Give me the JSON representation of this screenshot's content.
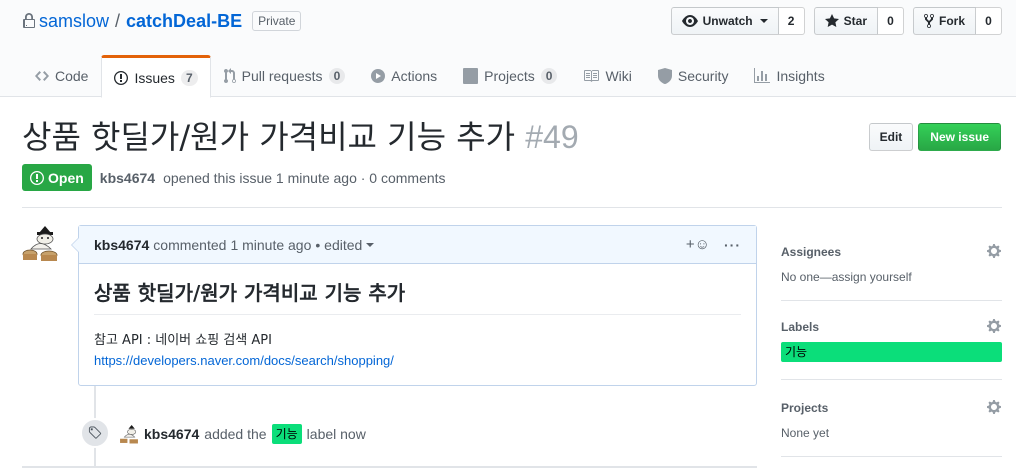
{
  "repo": {
    "owner": "samslow",
    "separator": "/",
    "name": "catchDeal-BE",
    "visibility": "Private"
  },
  "actions": {
    "watch": {
      "label": "Unwatch",
      "count": "2"
    },
    "star": {
      "label": "Star",
      "count": "0"
    },
    "fork": {
      "label": "Fork",
      "count": "0"
    }
  },
  "tabs": [
    {
      "label": "Code"
    },
    {
      "label": "Issues",
      "count": "7"
    },
    {
      "label": "Pull requests",
      "count": "0"
    },
    {
      "label": "Actions"
    },
    {
      "label": "Projects",
      "count": "0"
    },
    {
      "label": "Wiki"
    },
    {
      "label": "Security"
    },
    {
      "label": "Insights"
    }
  ],
  "issue": {
    "title": "상품 핫딜가/원가 가격비교 기능 추가",
    "number": "#49",
    "state": "Open",
    "author": "kbs4674",
    "meta": "opened this issue 1 minute ago · 0 comments",
    "edit_label": "Edit",
    "new_issue_label": "New issue"
  },
  "comment": {
    "author": "kbs4674",
    "action": "commented",
    "time": "1 minute ago",
    "edited": "• edited",
    "heading": "상품 핫딜가/원가 가격비교 기능 추가",
    "text": "참고 API : 네이버 쇼핑 검색 API",
    "link": "https://developers.naver.com/docs/search/shopping/",
    "more": "···",
    "emoji": "+☺"
  },
  "event": {
    "author": "kbs4674",
    "added_the": "added the",
    "label": "기능",
    "suffix": "label now"
  },
  "sidebar": {
    "assignees": {
      "title": "Assignees",
      "value": "No one—assign yourself"
    },
    "labels": {
      "title": "Labels",
      "label": "기능",
      "label_color": "#0bde7a"
    },
    "projects": {
      "title": "Projects",
      "value": "None yet"
    }
  },
  "colors": {
    "link": "#0366d6",
    "open": "#28a745",
    "tab_accent": "#e36209",
    "new_issue": "#2cbe4e"
  }
}
